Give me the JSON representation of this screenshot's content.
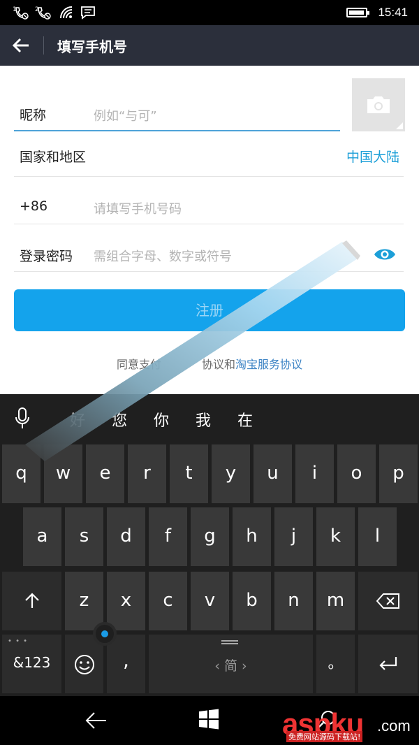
{
  "status_bar": {
    "time": "15:41",
    "icons": [
      "missed-call-icon",
      "missed-call-icon",
      "wifi-icon",
      "message-icon",
      "battery-icon"
    ],
    "battery_level": 0.9
  },
  "header": {
    "title": "填写手机号"
  },
  "form": {
    "nickname_label": "昵称",
    "nickname_placeholder": "例如“与可”",
    "region_label": "国家和地区",
    "region_value": "中国大陆",
    "phone_prefix": "+86",
    "phone_placeholder": "请填写手机号码",
    "password_label": "登录密码",
    "password_placeholder": "需组合字母、数字或符号",
    "register_label": "注册",
    "agreement_prefix": "同意支付",
    "agreement_mid": "协议和",
    "agreement_link": "淘宝服务协议"
  },
  "keyboard": {
    "candidates": [
      "好",
      "您",
      "你",
      "我",
      "在"
    ],
    "row1": [
      "q",
      "w",
      "e",
      "r",
      "t",
      "y",
      "u",
      "i",
      "o",
      "p"
    ],
    "row2": [
      "a",
      "s",
      "d",
      "f",
      "g",
      "h",
      "j",
      "k",
      "l"
    ],
    "row3": [
      "z",
      "x",
      "c",
      "v",
      "b",
      "n",
      "m"
    ],
    "numbers_label": "&123",
    "comma_label": ",",
    "space_label": "简",
    "period_label": "。",
    "ellipsis": "• • •"
  },
  "watermark": {
    "text": "aspku",
    "domain": ".com",
    "sub": "免费网站源码下载站!"
  },
  "colors": {
    "header_bg": "#2b2f3b",
    "accent": "#14a3ec",
    "link": "#1c9fd8",
    "keyboard_bg": "#1f1f1f",
    "key_bg": "#393939"
  }
}
